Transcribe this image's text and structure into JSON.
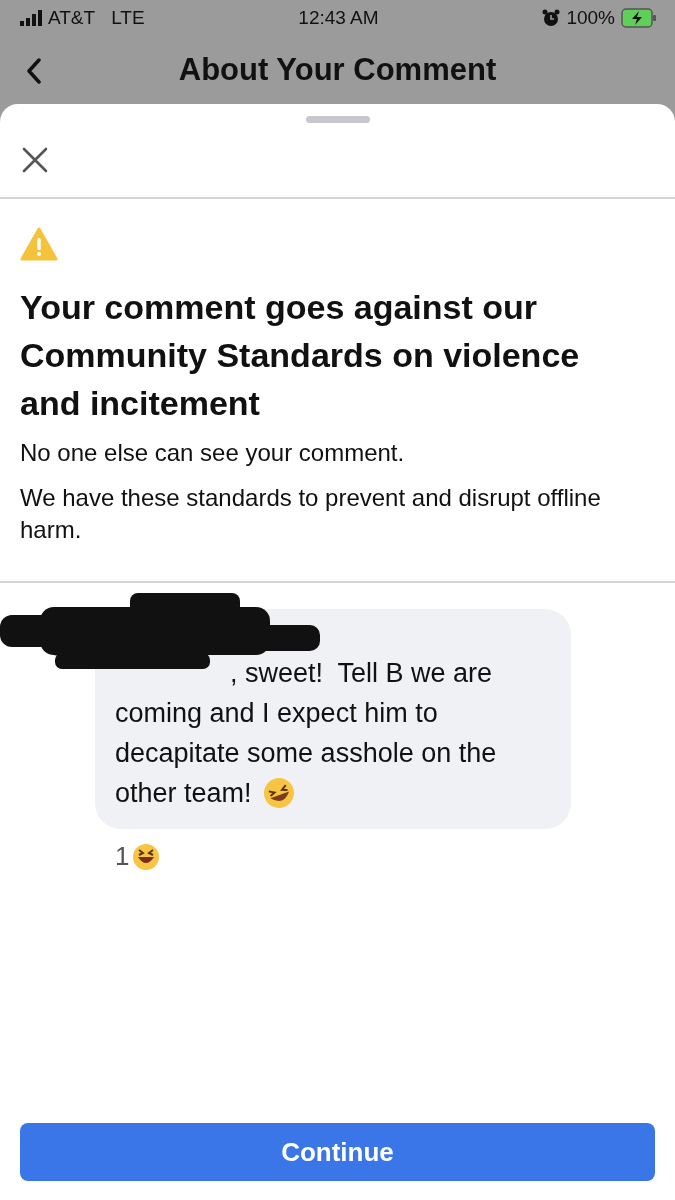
{
  "status_bar": {
    "carrier": "AT&T",
    "network": "LTE",
    "time": "12:43 AM",
    "battery": "100%"
  },
  "nav": {
    "title": "About Your Comment"
  },
  "notice": {
    "heading": "Your comment goes against our Community Standards on violence and incitement",
    "paragraphs": [
      "No one else can see your comment.",
      "We have these standards to prevent and disrupt offline harm."
    ]
  },
  "comment": {
    "lines": [
      ", sweet!  Tell B we are",
      "coming and I expect him to",
      "decapitate some asshole on the",
      "other team!"
    ],
    "reaction_count": "1"
  },
  "button": {
    "label": "Continue"
  }
}
